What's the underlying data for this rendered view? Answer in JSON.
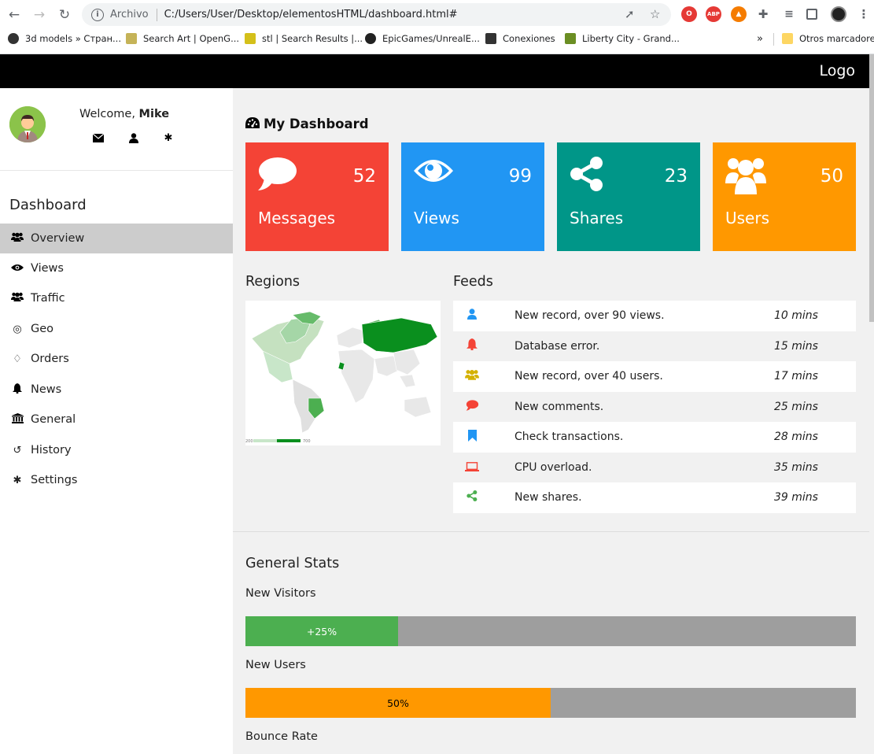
{
  "browser": {
    "address_label": "Archivo",
    "url": "C:/Users/User/Desktop/elementosHTML/dashboard.html#",
    "bookmarks": [
      {
        "label": "3d models » Стран..."
      },
      {
        "label": "Search Art | OpenG..."
      },
      {
        "label": "stl | Search Results |..."
      },
      {
        "label": "EpicGames/UnrealE..."
      },
      {
        "label": "Conexiones"
      },
      {
        "label": "Liberty City - Grand..."
      }
    ],
    "more_bookmarks": "»",
    "other_bookmarks": "Otros marcadores",
    "ext_abp": "ABP"
  },
  "header": {
    "logo": "Logo"
  },
  "sidebar": {
    "welcome_prefix": "Welcome, ",
    "user_name": "Mike",
    "heading": "Dashboard",
    "items": [
      {
        "label": "Overview",
        "icon": "users-icon"
      },
      {
        "label": "Views",
        "icon": "eye-icon"
      },
      {
        "label": "Traffic",
        "icon": "users-icon"
      },
      {
        "label": "Geo",
        "icon": "bullseye-icon"
      },
      {
        "label": "Orders",
        "icon": "diamond-icon"
      },
      {
        "label": "News",
        "icon": "bell-icon"
      },
      {
        "label": "General",
        "icon": "bank-icon"
      },
      {
        "label": "History",
        "icon": "history-icon"
      },
      {
        "label": "Settings",
        "icon": "cog-icon"
      }
    ]
  },
  "dashboard": {
    "title": "My Dashboard",
    "cards": [
      {
        "label": "Messages",
        "value": "52",
        "color": "#f44336",
        "icon": "comment-icon"
      },
      {
        "label": "Views",
        "value": "99",
        "color": "#2196f3",
        "icon": "eye-icon"
      },
      {
        "label": "Shares",
        "value": "23",
        "color": "#009688",
        "icon": "share-icon"
      },
      {
        "label": "Users",
        "value": "50",
        "color": "#ff9800",
        "icon": "users-icon"
      }
    ]
  },
  "regions": {
    "title": "Regions",
    "legend_min": "200",
    "legend_max": "700"
  },
  "feeds": {
    "title": "Feeds",
    "items": [
      {
        "text": "New record, over 90 views.",
        "time": "10 mins",
        "icon": "user-icon",
        "color": "#2196f3"
      },
      {
        "text": "Database error.",
        "time": "15 mins",
        "icon": "bell-icon",
        "color": "#f44336"
      },
      {
        "text": "New record, over 40 users.",
        "time": "17 mins",
        "icon": "users-icon",
        "color": "#ffc107"
      },
      {
        "text": "New comments.",
        "time": "25 mins",
        "icon": "comment-icon",
        "color": "#f44336"
      },
      {
        "text": "Check transactions.",
        "time": "28 mins",
        "icon": "bookmark-icon",
        "color": "#2196f3"
      },
      {
        "text": "CPU overload.",
        "time": "35 mins",
        "icon": "laptop-icon",
        "color": "#f44336"
      },
      {
        "text": "New shares.",
        "time": "39 mins",
        "icon": "share-icon",
        "color": "#4caf50"
      }
    ]
  },
  "stats": {
    "title": "General Stats",
    "bars": [
      {
        "label": "New Visitors",
        "text": "+25%",
        "percent": 25,
        "color": "#4caf50",
        "text_color": "#ffffff"
      },
      {
        "label": "New Users",
        "text": "50%",
        "percent": 50,
        "color": "#ff9800",
        "text_color": "#000000"
      },
      {
        "label": "Bounce Rate"
      }
    ]
  }
}
